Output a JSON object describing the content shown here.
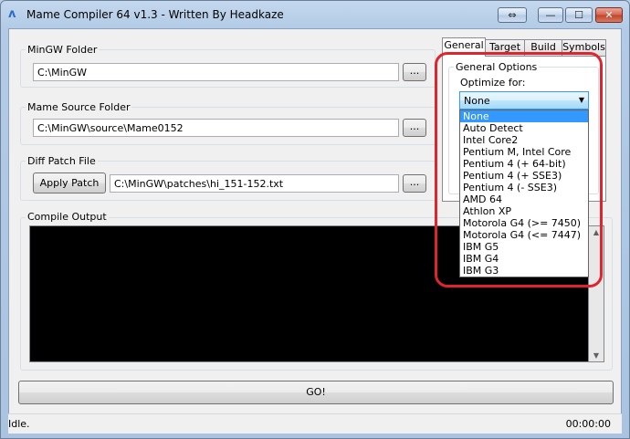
{
  "window": {
    "title": "Mame Compiler 64 v1.3 - Written By Headkaze",
    "restore_glyph": "⇔",
    "minimize_glyph": "—",
    "maximize_glyph": "☐",
    "close_glyph": "✕"
  },
  "mingw": {
    "label": "MinGW Folder",
    "value": "C:\\MinGW",
    "browse_label": "..."
  },
  "source": {
    "label": "Mame Source Folder",
    "value": "C:\\MinGW\\source\\Mame0152",
    "browse_label": "..."
  },
  "patch": {
    "label": "Diff Patch File",
    "apply_label": "Apply Patch",
    "value": "C:\\MinGW\\patches\\hi_151-152.txt",
    "browse_label": "..."
  },
  "output": {
    "label": "Compile Output"
  },
  "tabs": [
    {
      "label": "General"
    },
    {
      "label": "Target"
    },
    {
      "label": "Build"
    },
    {
      "label": "Symbols"
    }
  ],
  "general": {
    "group_label": "General Options",
    "optimize_label": "Optimize for:",
    "selected": "None",
    "options": [
      "None",
      "Auto Detect",
      "Intel Core2",
      "Pentium M, Intel Core",
      "Pentium 4 (+ 64-bit)",
      "Pentium 4 (+ SSE3)",
      "Pentium 4 (- SSE3)",
      "AMD 64",
      "Athlon XP",
      "Motorola G4 (>= 7450)",
      "Motorola G4 (<= 7447)",
      "IBM G5",
      "IBM G4",
      "IBM G3"
    ]
  },
  "go_label": "GO!",
  "status": {
    "text": "Idle.",
    "time": "00:00:00"
  },
  "colors": {
    "highlight": "#e0242d",
    "selection": "#3399ff",
    "console": "#000000"
  },
  "icons": {
    "app": "mame-logo-icon",
    "dropdown": "chevron-down-icon"
  }
}
